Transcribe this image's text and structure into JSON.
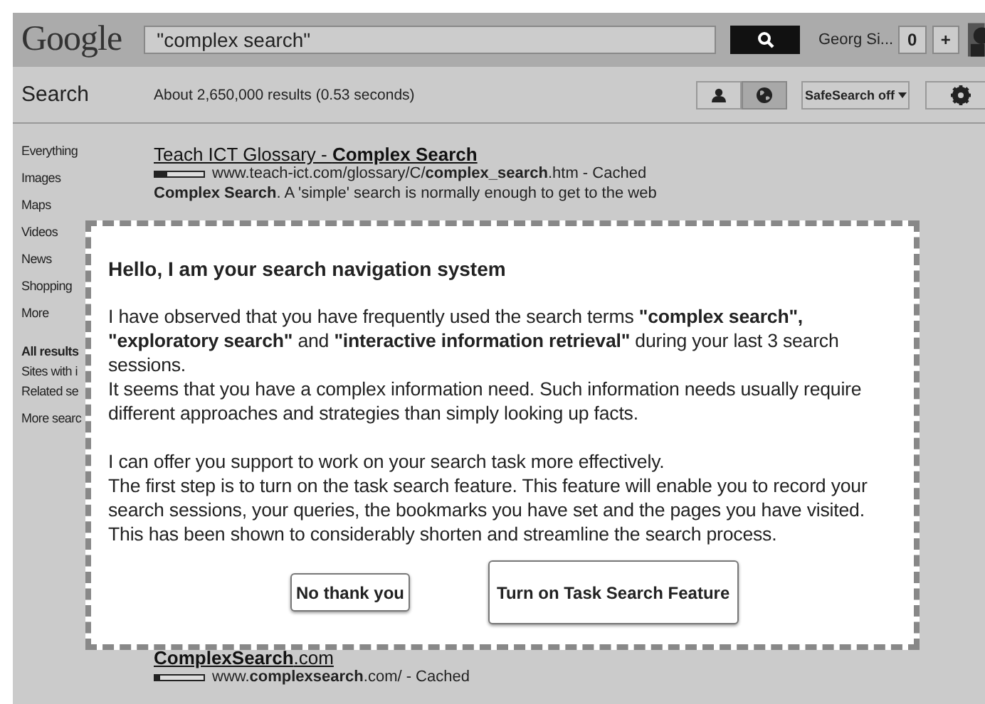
{
  "header": {
    "logo": "Google",
    "search_query": "\"complex search\"",
    "user_name": "Georg Si...",
    "notification_count": "0",
    "share_label": "+"
  },
  "toolbar": {
    "title": "Search",
    "result_stats": "About 2,650,000 results (0.53 seconds)",
    "view_toggle": [
      {
        "kind": "personal",
        "selected": false
      },
      {
        "kind": "world",
        "selected": true
      }
    ],
    "safesearch": "SafeSearch off"
  },
  "sidebar": {
    "items": [
      "Everything",
      "Images",
      "Maps",
      "Videos",
      "News",
      "Shopping",
      "More"
    ],
    "filters": [
      {
        "label": "All results",
        "selected": true
      },
      {
        "label": "Sites with i",
        "selected": false
      },
      {
        "label": "Related se",
        "selected": false
      }
    ],
    "more_tools": "More searc"
  },
  "results": [
    {
      "title": "Teach ICT Glossary - **Complex Search**",
      "url": "www.teach-ict.com/glossary/C/**complex_search**.htm - Cached",
      "snippet": "**Complex Search**. A 'simple' search is normally enough to get to the web"
    },
    {
      "title": "**ComplexSearch**.com",
      "url": "www.**complexsearch**.com/ - Cached"
    }
  ],
  "dialog": {
    "heading": "Hello, I am your search navigation system",
    "paragraphs": [
      [
        "I have observed that you have frequently used the search terms **\"complex search\", \"exploratory search\"** and **\"interactive information retrieval\"** during your last 3 search sessions.",
        "It seems that you have a complex information need. Such information needs usually require different approaches and strategies than simply looking up facts."
      ],
      [
        "I can offer you support to work on your search task more effectively.",
        "The first step is to turn on the task search feature. This feature will enable you to record your search sessions, your queries, the bookmarks you have set and the pages you have visited. This has been shown to considerably shorten and streamline the search process."
      ]
    ],
    "buttons": [
      {
        "label": "No thank you",
        "kind": "secondary"
      },
      {
        "label": "Turn on Task Search Feature",
        "kind": "primary"
      }
    ]
  }
}
